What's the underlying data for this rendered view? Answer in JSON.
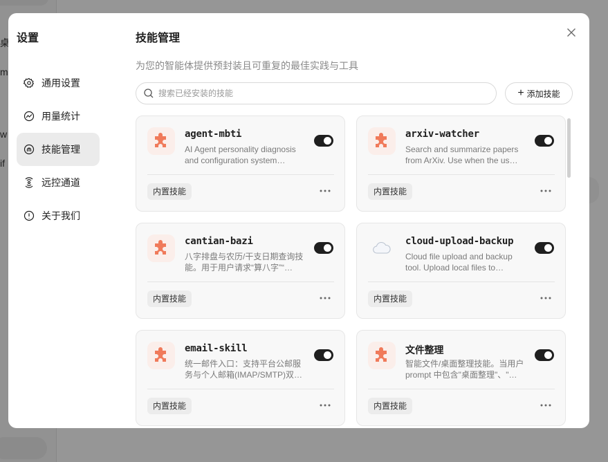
{
  "background": {
    "fragments": [
      "桌",
      "mg",
      "w",
      "if"
    ]
  },
  "settings": {
    "title": "设置",
    "nav": [
      {
        "label": "通用设置",
        "icon": "gear-icon"
      },
      {
        "label": "用量统计",
        "icon": "chart-icon"
      },
      {
        "label": "技能管理",
        "icon": "brain-icon",
        "active": true
      },
      {
        "label": "远控通道",
        "icon": "remote-icon"
      },
      {
        "label": "关于我们",
        "icon": "info-icon"
      }
    ]
  },
  "skills": {
    "title": "技能管理",
    "subtitle": "为您的智能体提供预封装且可重复的最佳实践与工具",
    "search_placeholder": "搜索已经安装的技能",
    "add_label": "添加技能",
    "items": [
      {
        "name": "agent-mbti",
        "desc": "AI Agent personality diagnosis and configuration system…",
        "badge": "内置技能",
        "enabled": true,
        "icon": "puzzle-icon"
      },
      {
        "name": "arxiv-watcher",
        "desc": "Search and summarize papers from ArXiv. Use when the us…",
        "badge": "内置技能",
        "enabled": true,
        "icon": "puzzle-icon"
      },
      {
        "name": "cantian-bazi",
        "desc": "八字排盘与农历/干支日期查询技能。用于用户请求“算八字”“…",
        "badge": "内置技能",
        "enabled": true,
        "icon": "puzzle-icon"
      },
      {
        "name": "cloud-upload-backup",
        "desc": "Cloud file upload and backup tool. Upload local files to…",
        "badge": "内置技能",
        "enabled": true,
        "icon": "cloud-icon"
      },
      {
        "name": "email-skill",
        "desc": "统一邮件入口：支持平台公邮服务与个人邮箱(IMAP/SMTP)双…",
        "badge": "内置技能",
        "enabled": true,
        "icon": "puzzle-icon"
      },
      {
        "name": "文件整理",
        "desc": "智能文件/桌面整理技能。当用户 prompt 中包含\"桌面整理\"、\"…",
        "badge": "内置技能",
        "enabled": true,
        "icon": "puzzle-icon"
      }
    ]
  },
  "colors": {
    "accent": "#f07a5a",
    "toggle_on": "#1f1f1f",
    "active_nav": "#ebebeb"
  }
}
